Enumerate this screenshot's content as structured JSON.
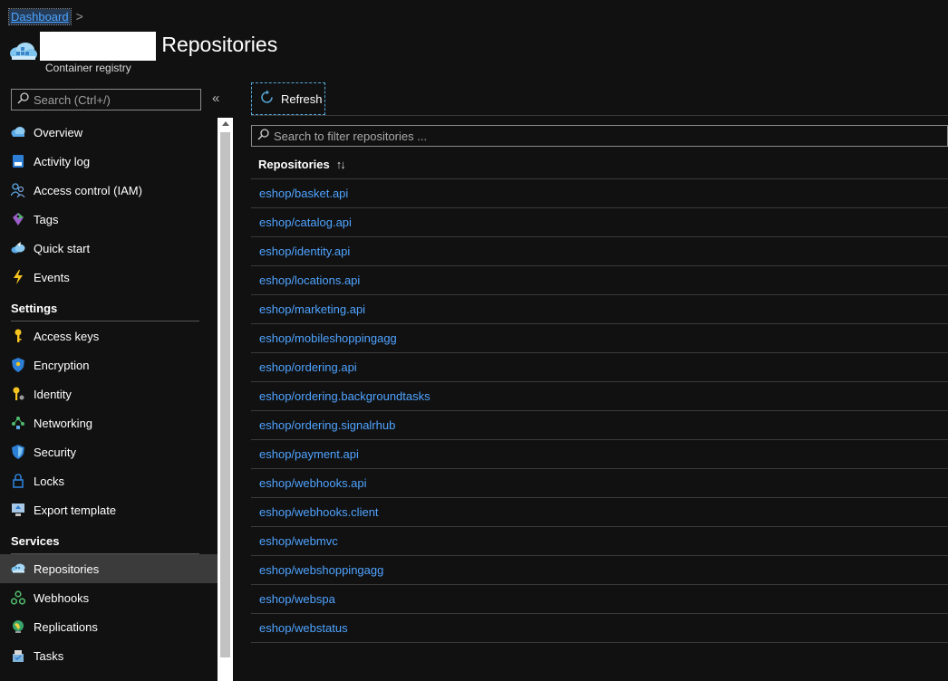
{
  "breadcrumb": {
    "link": "Dashboard",
    "separator": ">"
  },
  "header": {
    "title": "| Repositories",
    "subtitle": "Container registry"
  },
  "sidebar": {
    "search_placeholder": "Search (Ctrl+/)",
    "collapse": "«",
    "items": [
      {
        "label": "Overview",
        "icon": "cloud-overview-icon"
      },
      {
        "label": "Activity log",
        "icon": "activity-log-icon"
      },
      {
        "label": "Access control (IAM)",
        "icon": "people-icon"
      },
      {
        "label": "Tags",
        "icon": "tag-icon"
      },
      {
        "label": "Quick start",
        "icon": "quickstart-cloud-icon"
      },
      {
        "label": "Events",
        "icon": "lightning-icon"
      }
    ],
    "settings_header": "Settings",
    "settings_items": [
      {
        "label": "Access keys",
        "icon": "key-icon"
      },
      {
        "label": "Encryption",
        "icon": "shield-icon"
      },
      {
        "label": "Identity",
        "icon": "identity-key-icon"
      },
      {
        "label": "Networking",
        "icon": "network-icon"
      },
      {
        "label": "Security",
        "icon": "security-shield-icon"
      },
      {
        "label": "Locks",
        "icon": "lock-icon"
      },
      {
        "label": "Export template",
        "icon": "export-icon"
      }
    ],
    "services_header": "Services",
    "services_items": [
      {
        "label": "Repositories",
        "icon": "repositories-cloud-icon",
        "active": true
      },
      {
        "label": "Webhooks",
        "icon": "webhooks-icon"
      },
      {
        "label": "Replications",
        "icon": "globe-icon"
      },
      {
        "label": "Tasks",
        "icon": "tasks-icon"
      }
    ]
  },
  "toolbar": {
    "refresh_label": "Refresh"
  },
  "filter": {
    "placeholder": "Search to filter repositories ..."
  },
  "grid": {
    "column": "Repositories",
    "sort_glyph": "↑↓",
    "rows": [
      "eshop/basket.api",
      "eshop/catalog.api",
      "eshop/identity.api",
      "eshop/locations.api",
      "eshop/marketing.api",
      "eshop/mobileshoppingagg",
      "eshop/ordering.api",
      "eshop/ordering.backgroundtasks",
      "eshop/ordering.signalrhub",
      "eshop/payment.api",
      "eshop/webhooks.api",
      "eshop/webhooks.client",
      "eshop/webmvc",
      "eshop/webshoppingagg",
      "eshop/webspa",
      "eshop/webstatus"
    ]
  },
  "colors": {
    "link": "#4fa3ff",
    "background": "#111111",
    "active_row": "#3b3b3b",
    "accent_border": "#55a7d8"
  }
}
